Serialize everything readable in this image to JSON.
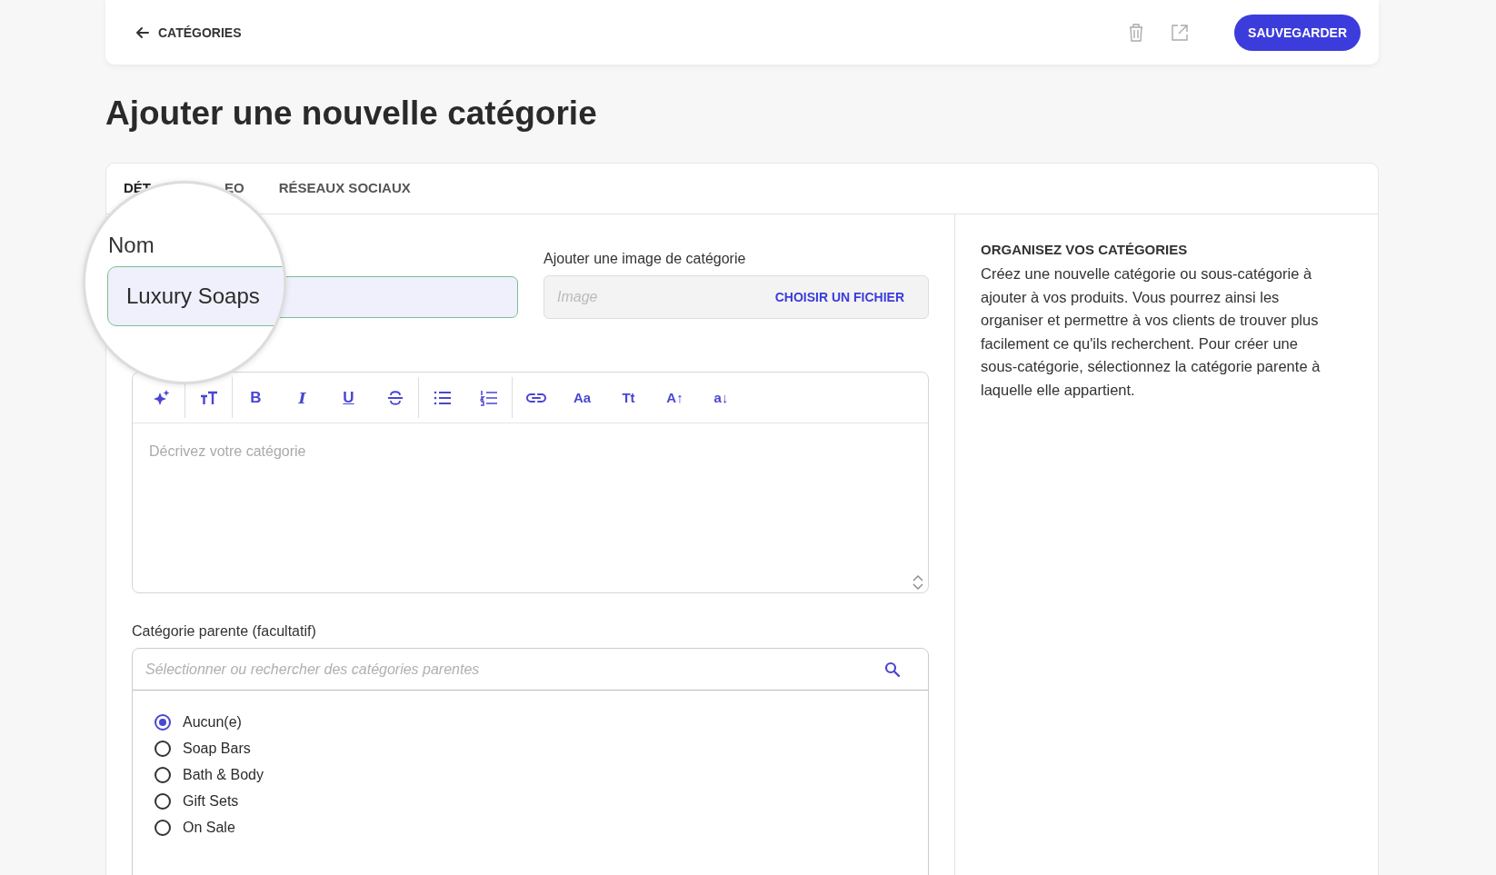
{
  "topbar": {
    "back_link": "CATÉGORIES",
    "save_button": "SAUVEGARDER"
  },
  "title": "Ajouter une nouvelle catégorie",
  "tabs": [
    {
      "label": "DÉT",
      "selected": true
    },
    {
      "label": "EO",
      "selected": false
    },
    {
      "label": "RÉSEAUX SOCIAUX",
      "selected": false
    }
  ],
  "name_field": {
    "label": "Nom",
    "value": "Luxury Soaps"
  },
  "image_field": {
    "label": "Ajouter une image de catégorie",
    "placeholder": "Image",
    "button": "CHOISIR UN FICHIER"
  },
  "editor": {
    "toolbar": [
      [
        {
          "kind": "sparkle"
        }
      ],
      [
        {
          "kind": "font-size"
        }
      ],
      [
        {
          "kind": "bold",
          "label": "B"
        },
        {
          "kind": "italic",
          "label": "I"
        },
        {
          "kind": "underline",
          "label": "U"
        },
        {
          "kind": "strike"
        }
      ],
      [
        {
          "kind": "bullets"
        },
        {
          "kind": "numbers"
        }
      ],
      [
        {
          "kind": "link"
        },
        {
          "kind": "text",
          "label": "Aa"
        },
        {
          "kind": "text",
          "label": "Tt"
        },
        {
          "kind": "text",
          "label": "A↑"
        },
        {
          "kind": "text",
          "label": "a↓"
        }
      ]
    ],
    "placeholder": "Décrivez votre catégorie"
  },
  "parent": {
    "label": "Catégorie parente (facultatif)",
    "placeholder": "Sélectionner ou rechercher des catégories parentes",
    "options": [
      {
        "label": "Aucun(e)",
        "selected": true
      },
      {
        "label": "Soap Bars",
        "selected": false
      },
      {
        "label": "Bath & Body",
        "selected": false
      },
      {
        "label": "Gift Sets",
        "selected": false
      },
      {
        "label": "On Sale",
        "selected": false
      }
    ]
  },
  "help": {
    "title": "ORGANISEZ VOS CATÉGORIES",
    "text": "Créez une nouvelle catégorie ou sous-catégorie à ajouter à vos produits. Vous pourrez ainsi les organiser et permettre à vos clients de trouver plus facilement ce qu'ils recherchent. Pour créer une sous-catégorie, sélectionnez la catégorie parente à laquelle elle appartient."
  }
}
